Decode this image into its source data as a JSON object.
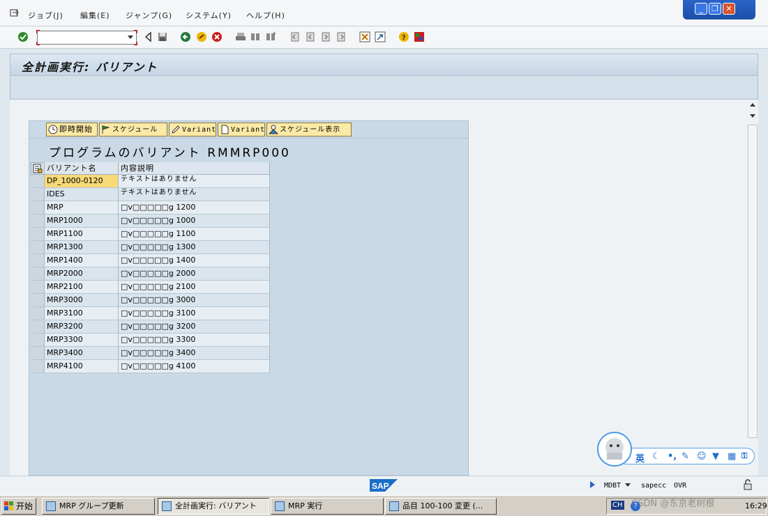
{
  "menu": {
    "items": [
      "ジョブ(J)",
      "編集(E)",
      "ジャンプ(G)",
      "システム(Y)",
      "ヘルプ(H)"
    ]
  },
  "window_controls": {
    "minimize": "_",
    "restore": "❐",
    "close": "✕"
  },
  "toolbar": {
    "command_field_value": "",
    "icons": [
      "enter-icon",
      "save-icon",
      "back-icon",
      "exit-icon",
      "cancel-icon",
      "print-icon",
      "find-icon",
      "find-next-icon",
      "first-page-icon",
      "prev-page-icon",
      "next-page-icon",
      "last-page-icon",
      "create-session-icon",
      "shortcut-icon",
      "help-icon",
      "customize-layout-icon"
    ]
  },
  "title": "全計画実行: バリアント",
  "panel": {
    "buttons": [
      {
        "label": "即時開始",
        "icon": "clock-icon"
      },
      {
        "label": "スケジュール",
        "icon": "flag-icon"
      },
      {
        "label": "Variant",
        "icon": "pencil-icon"
      },
      {
        "label": "Variant",
        "icon": "document-icon"
      },
      {
        "label": "スケジュール表示",
        "icon": "person-icon"
      }
    ],
    "program_title": "プログラムのバリアント RMMRP000",
    "table": {
      "columns": [
        "バリアント名",
        "内容説明"
      ],
      "rows": [
        {
          "name": "DP_1000-0120",
          "desc": "テキストはありません"
        },
        {
          "name": "IDES",
          "desc": "テキストはありません"
        },
        {
          "name": "MRP",
          "desc": "□v□□□□□g 1200"
        },
        {
          "name": "MRP1000",
          "desc": "□v□□□□□g 1000"
        },
        {
          "name": "MRP1100",
          "desc": "□v□□□□□g 1100"
        },
        {
          "name": "MRP1300",
          "desc": "□v□□□□□g 1300"
        },
        {
          "name": "MRP1400",
          "desc": "□v□□□□□g 1400"
        },
        {
          "name": "MRP2000",
          "desc": "□v□□□□□g 2000"
        },
        {
          "name": "MRP2100",
          "desc": "□v□□□□□g 2100"
        },
        {
          "name": "MRP3000",
          "desc": "□v□□□□□g 3000"
        },
        {
          "name": "MRP3100",
          "desc": "□v□□□□□g 3100"
        },
        {
          "name": "MRP3200",
          "desc": "□v□□□□□g 3200"
        },
        {
          "name": "MRP3300",
          "desc": "□v□□□□□g 3300"
        },
        {
          "name": "MRP3400",
          "desc": "□v□□□□□g 3400"
        },
        {
          "name": "MRP4100",
          "desc": "□v□□□□□g 4100"
        }
      ]
    }
  },
  "status": {
    "logo": "SAP",
    "system": "MDBT",
    "server": "sapecc",
    "mode": "OVR"
  },
  "ime": {
    "language": "英"
  },
  "taskbar": {
    "start": "开始",
    "tasks": [
      "MRP グループ更新",
      "全計画実行: バリアント",
      "MRP 実行",
      "品目 100-100 変更 (..."
    ],
    "lang": "CH",
    "clock": "16:29"
  },
  "watermark": "CSDN @东京老树根"
}
